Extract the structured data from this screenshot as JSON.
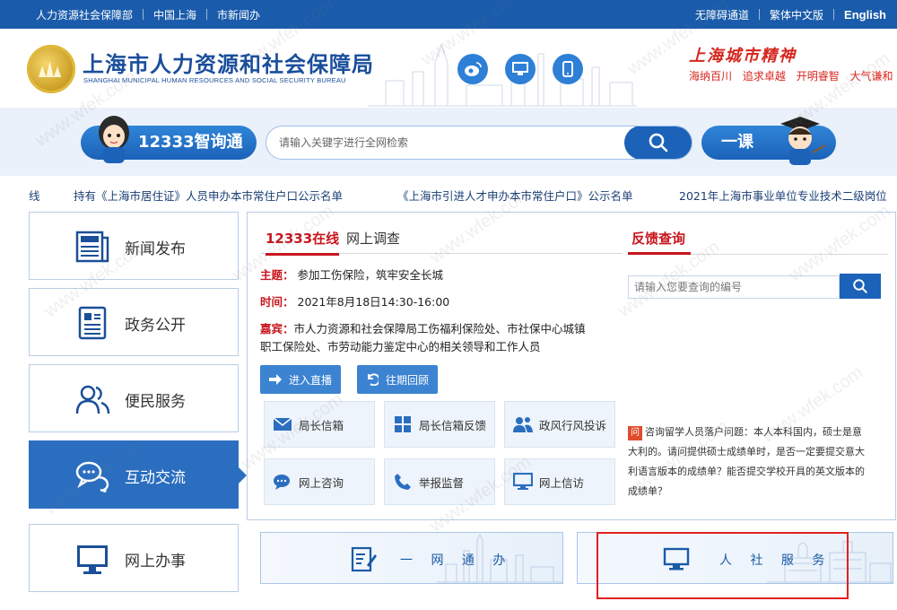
{
  "topbar": {
    "left": [
      "人力资源社会保障部",
      "中国上海",
      "市新闻办"
    ],
    "right": [
      "无障碍通道",
      "繁体中文版",
      "English"
    ]
  },
  "header": {
    "title": "上海市人力资源和社会保障局",
    "subtitle": "SHANGHAI MUNICIPAL HUMAN RESOURCES AND SOCIAL SECURITY BUREAU",
    "spirit_title": "上海城市精神",
    "spirit_words": [
      "海纳百川",
      "追求卓越",
      "开明睿智",
      "大气谦和"
    ],
    "icons": [
      "weibo-icon",
      "desktop-icon",
      "mobile-icon"
    ]
  },
  "search": {
    "zx_label": "12333智询通",
    "placeholder": "请输入关键字进行全网检索",
    "yk_label": "一课"
  },
  "ticker": [
    "线",
    "持有《上海市居住证》人员申办本市常住户口公示名单",
    "《上海市引进人才申办本市常住户口》公示名单",
    "2021年上海市事业单位专业技术二级岗位"
  ],
  "nav": [
    {
      "label": "新闻发布"
    },
    {
      "label": "政务公开"
    },
    {
      "label": "便民服务"
    },
    {
      "label": "互动交流"
    },
    {
      "label": "网上办事"
    }
  ],
  "panel": {
    "tab_active": "12333在线",
    "tab_other": "网上调查",
    "topic_key": "主题：",
    "topic": "参加工伤保险，筑牢安全长城",
    "time_key": "时间：",
    "time": "2021年8月18日14:30-16:00",
    "guest_key": "嘉宾：",
    "guest_line1": "市人力资源和社会保障局工伤福利保险处、市社保中心城镇",
    "guest_line2": "职工保险处、市劳动能力鉴定中心的相关领导和工作人员",
    "live_btn": "进入直播",
    "review_btn": "往期回顾",
    "tiles": [
      "局长信箱",
      "局长信箱反馈",
      "政风行风投诉",
      "网上咨询",
      "举报监督",
      "网上信访"
    ]
  },
  "feedback": {
    "title": "反馈查询",
    "placeholder": "请输入您要查询的编号",
    "badge": "问",
    "qa_line1": "咨询留学人员落户问题：本人本科国内，硕士是意",
    "qa_line2": "大利的。请问提供硕士成绩单时，是否一定要提交意大",
    "qa_line3": "利语言版本的成绩单？能否提交学校开具的英文版本的",
    "qa_line4": "成绩单？"
  },
  "bottom": {
    "left_label": "一 网 通 办",
    "right_label": "人 社 服 务"
  },
  "watermark": "www.wfek.com",
  "colors": {
    "brand": "#1a5cab",
    "accent": "#c8161d",
    "nav_active": "#2b6ec0",
    "highlight": "#e02020"
  }
}
